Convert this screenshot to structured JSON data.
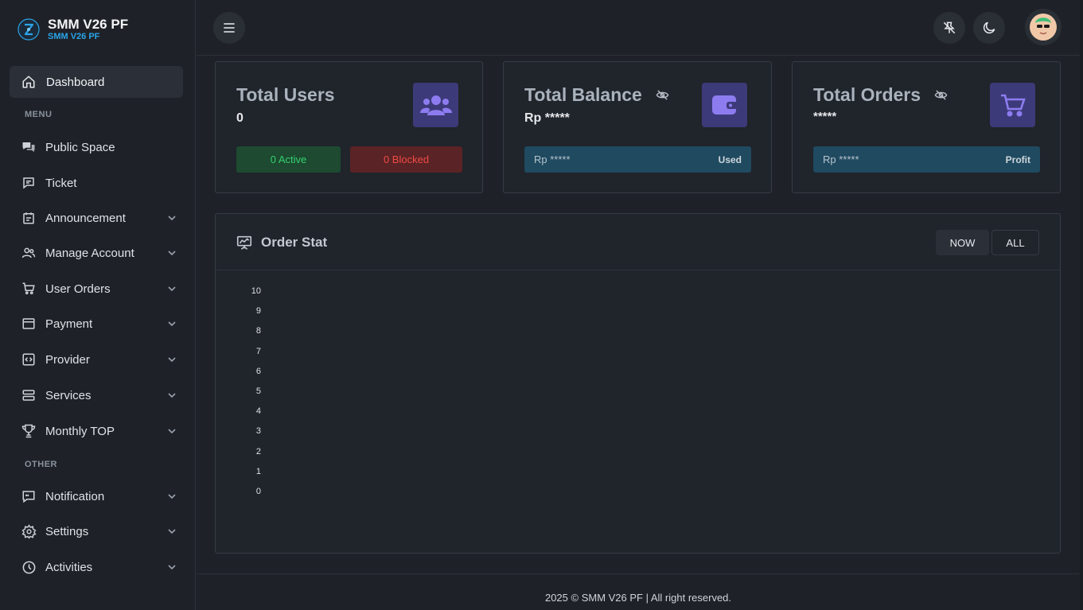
{
  "brand": {
    "title": "SMM V26 PF",
    "subtitle": "SMM V26 PF"
  },
  "sidebar": {
    "active": {
      "label": "Dashboard",
      "icon": "home-icon"
    },
    "sections": [
      "MENU",
      "OTHER"
    ],
    "items": [
      {
        "label": "Public Space",
        "icon": "chat-icon",
        "chevron": false
      },
      {
        "label": "Ticket",
        "icon": "message-icon",
        "chevron": false
      },
      {
        "label": "Announcement",
        "icon": "calendar-icon",
        "chevron": true
      },
      {
        "label": "Manage Account",
        "icon": "users-icon",
        "chevron": true
      },
      {
        "label": "User Orders",
        "icon": "cart-icon",
        "chevron": true
      },
      {
        "label": "Payment",
        "icon": "window-icon",
        "chevron": true
      },
      {
        "label": "Provider",
        "icon": "code-icon",
        "chevron": true
      },
      {
        "label": "Services",
        "icon": "server-icon",
        "chevron": true
      },
      {
        "label": "Monthly TOP",
        "icon": "trophy-icon",
        "chevron": true
      },
      {
        "label": "Notification",
        "icon": "quote-icon",
        "chevron": true
      },
      {
        "label": "Settings",
        "icon": "gear-icon",
        "chevron": true
      },
      {
        "label": "Activities",
        "icon": "clock-icon",
        "chevron": true
      }
    ]
  },
  "header": {
    "menu_icon": "hamburger-icon",
    "buttons": [
      "pin-off-icon",
      "moon-icon"
    ],
    "avatar": "avatar"
  },
  "cards": {
    "users": {
      "title": "Total Users",
      "value": "0",
      "active": "0 Active",
      "blocked": "0 Blocked",
      "icon": "users-group-icon"
    },
    "balance": {
      "title": "Total Balance",
      "value": "Rp *****",
      "bar_left": "Rp *****",
      "bar_right": "Used",
      "icon": "wallet-icon"
    },
    "orders": {
      "title": "Total Orders",
      "value": "*****",
      "bar_left": "Rp *****",
      "bar_right": "Profit",
      "icon": "cart-icon"
    }
  },
  "order_stat": {
    "title": "Order Stat",
    "tabs": [
      "NOW",
      "ALL"
    ],
    "selected_tab": "NOW"
  },
  "chart_data": {
    "type": "line",
    "series": [],
    "y_ticks": [
      "10",
      "9",
      "8",
      "7",
      "6",
      "5",
      "4",
      "3",
      "2",
      "1",
      "0"
    ],
    "ylim": [
      0,
      10
    ]
  },
  "footer": {
    "text": "2025 © SMM V26 PF | All right reserved."
  },
  "colors": {
    "accent_icon_bg": "#3d3a7a",
    "active_green": "#2ec46a",
    "blocked_red": "#e0443e",
    "bar_blue": "#1f4a60",
    "brand_blue": "#2aa3e8"
  }
}
